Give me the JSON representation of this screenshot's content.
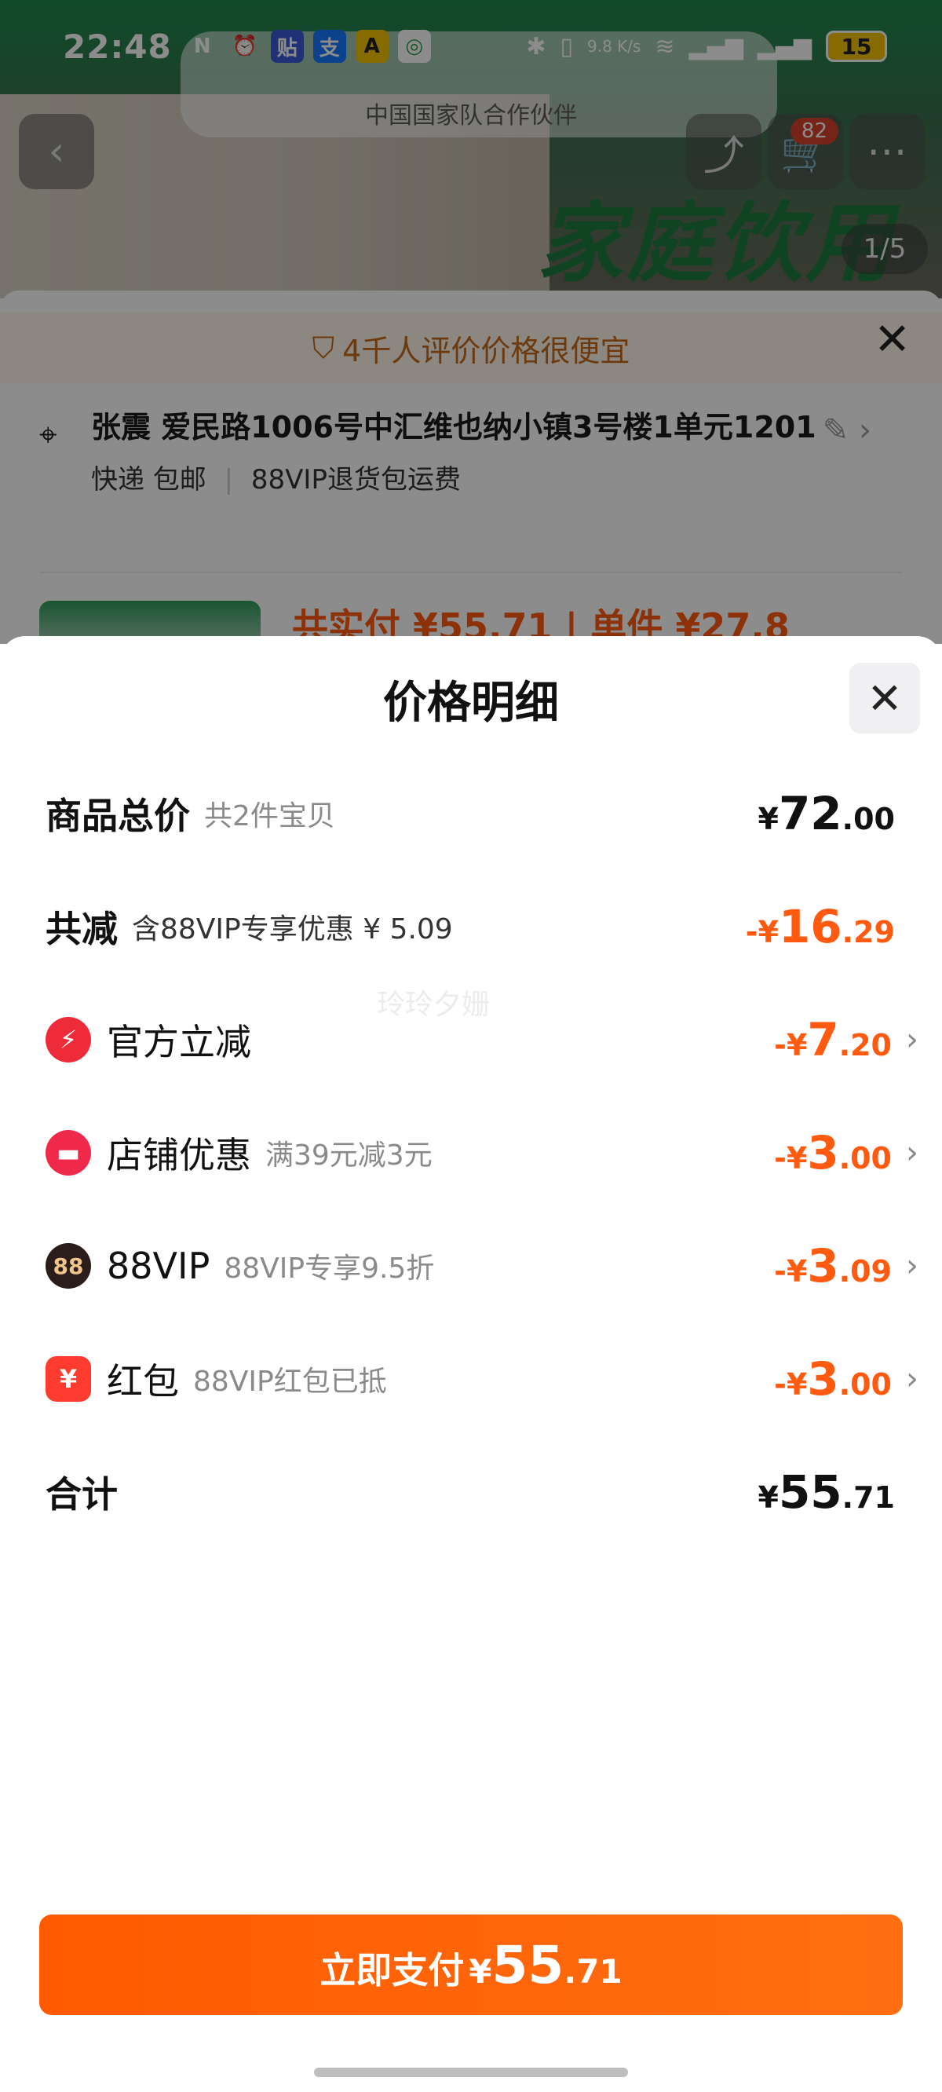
{
  "status_bar": {
    "time": "22:48",
    "net_speed": "9.8 K/s",
    "battery": "15"
  },
  "background": {
    "team_sub": "中国国家队合作伙伴",
    "banner_text": "家庭饮用",
    "image_counter": "1/5",
    "cart_count": "82",
    "notice": "4千人评价价格很便宜",
    "address_line": "张震 爱民路1006号中汇维也纳小镇3号楼1单元1201",
    "shipping": "快递 包邮",
    "return_policy": "88VIP退货包运费",
    "peek_price": "共实付 ¥55.71 | 单件 ¥27.8"
  },
  "sheet": {
    "title": "价格明细",
    "watermark": "玲玲夕姗",
    "rows": [
      {
        "label": "商品总价",
        "sub": "共2件宝贝",
        "sym": "¥",
        "int": "72",
        "dec": ".00",
        "tone": "black"
      },
      {
        "label": "共减",
        "sub": "含88VIP专享优惠 ¥ 5.09",
        "sym": "-¥",
        "int": "16",
        "dec": ".29",
        "tone": "orange"
      },
      {
        "label": "官方立减",
        "sub": "",
        "sym": "-¥",
        "int": "7",
        "dec": ".20",
        "tone": "orange",
        "icon": "lightning-icon"
      },
      {
        "label": "店铺优惠",
        "sub": "满39元减3元",
        "sym": "-¥",
        "int": "3",
        "dec": ".00",
        "tone": "orange",
        "icon": "shop-icon"
      },
      {
        "label": "88VIP",
        "sub": "88VIP专享9.5折",
        "sym": "-¥",
        "int": "3",
        "dec": ".09",
        "tone": "orange",
        "icon": "vip-88-icon",
        "icon_text": "88"
      },
      {
        "label": "红包",
        "sub": "88VIP红包已抵",
        "sym": "-¥",
        "int": "3",
        "dec": ".00",
        "tone": "orange",
        "icon": "red-packet-icon"
      },
      {
        "label": "合计",
        "sub": "",
        "sym": "¥",
        "int": "55",
        "dec": ".71",
        "tone": "black"
      }
    ],
    "pay_button": {
      "label": "立即支付",
      "sym": "¥",
      "int": "55",
      "dec": ".71"
    }
  },
  "colors": {
    "accent": "#ff5a10",
    "overlay": "rgba(0,0,0,0.45)"
  }
}
